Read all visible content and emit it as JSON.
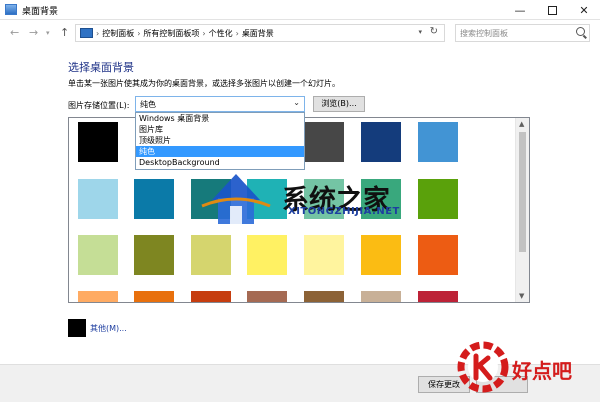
{
  "window": {
    "title": "桌面背景"
  },
  "address_bar": {
    "crumbs": [
      "控制面板",
      "所有控制面板项",
      "个性化",
      "桌面背景"
    ],
    "separator": "›"
  },
  "search": {
    "placeholder": "搜索控制面板"
  },
  "page": {
    "heading": "选择桌面背景",
    "instruction": "单击某一张图片使其成为你的桌面背景，或选择多张图片以创建一个幻灯片。"
  },
  "location": {
    "label": "图片存储位置(L):",
    "selected": "纯色",
    "options": [
      "Windows 桌面背景",
      "图片库",
      "顶级照片",
      "纯色",
      "DesktopBackground"
    ],
    "selected_index": 3,
    "browse_label": "浏览(B)..."
  },
  "colors": {
    "row1": [
      "#000000",
      "#ffffff",
      "#ffffff",
      "#ffffff",
      "#474747",
      "#143c7c",
      "#4294d4"
    ],
    "row2": [
      "#9ed6ea",
      "#0b7aa8",
      "#167a7b",
      "#1fb2b5",
      "#74c4a4",
      "#39a87d",
      "#5aa10b"
    ],
    "row3": [
      "#c5de96",
      "#7e8621",
      "#d5d56e",
      "#fff163",
      "#fff49e",
      "#fbbc13",
      "#ed5c13"
    ],
    "row4": [
      "#ffab63",
      "#e8700d",
      "#c63d0f",
      "#a56a53",
      "#8c6236",
      "#c8b097",
      "#bd2237"
    ]
  },
  "other": {
    "label": "其他(M)...",
    "color": "#000000"
  },
  "footer": {
    "save_label": "保存更改"
  },
  "watermark": {
    "main_text": "系统之家",
    "main_sub": "XITONGZHIJIA.NET",
    "corner_text": "好点吧"
  }
}
